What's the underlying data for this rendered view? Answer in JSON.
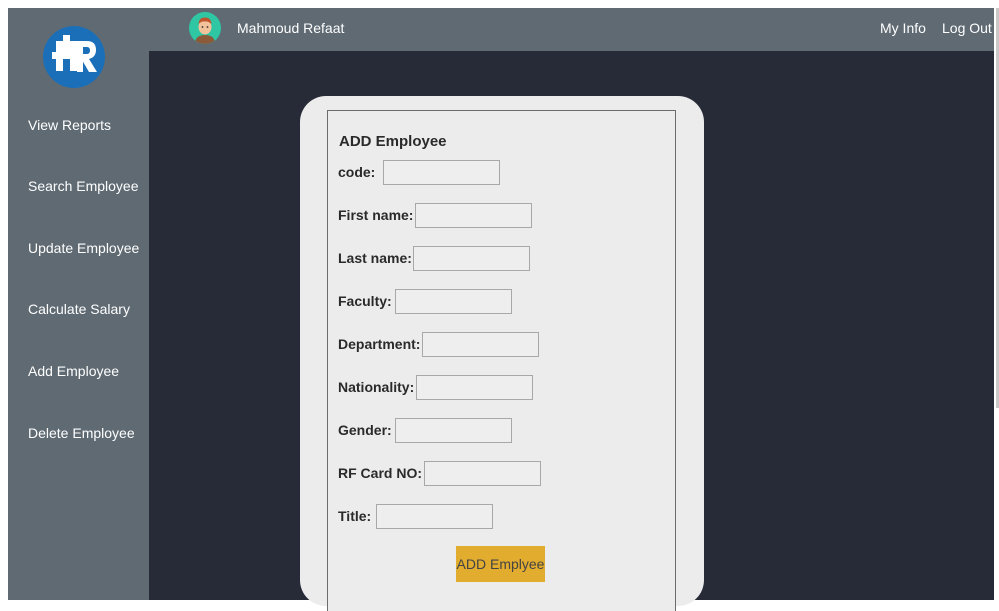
{
  "header": {
    "user_name": "Mahmoud Refaat",
    "my_info_label": "My Info",
    "logout_label": "Log Out"
  },
  "sidebar": {
    "logo_text": "HR",
    "items": [
      {
        "label": "View Reports"
      },
      {
        "label": "Search Employee"
      },
      {
        "label": "Update Employee"
      },
      {
        "label": "Calculate Salary"
      },
      {
        "label": "Add Employee"
      },
      {
        "label": "Delete Employee"
      }
    ]
  },
  "form": {
    "title": "ADD Employee",
    "fields": [
      {
        "label": "code:",
        "value": ""
      },
      {
        "label": "First name:",
        "value": ""
      },
      {
        "label": "Last name:",
        "value": ""
      },
      {
        "label": "Faculty:",
        "value": ""
      },
      {
        "label": "Department:",
        "value": ""
      },
      {
        "label": "Nationality:",
        "value": ""
      },
      {
        "label": "Gender:",
        "value": ""
      },
      {
        "label": "RF Card NO:",
        "value": ""
      },
      {
        "label": "Title:",
        "value": ""
      }
    ],
    "submit_label": "ADD Emplyee"
  },
  "colors": {
    "sidebar_bg": "#5f6a73",
    "main_bg": "#272b38",
    "card_bg": "#ececec",
    "button_accent": "#e2ad2e",
    "logo_blue": "#1b6fb8"
  }
}
